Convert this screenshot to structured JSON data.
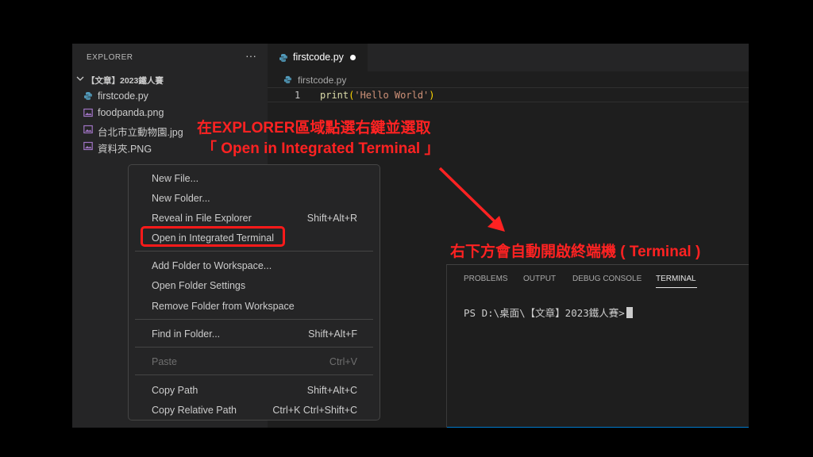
{
  "explorer": {
    "title": "EXPLORER",
    "more_icon": "ellipsis-icon",
    "folder": "【文章】2023鐵人賽",
    "files": [
      {
        "name": "firstcode.py",
        "icon": "python-icon"
      },
      {
        "name": "foodpanda.png",
        "icon": "image-icon"
      },
      {
        "name": "台北市立動物園.jpg",
        "icon": "image-icon"
      },
      {
        "name": "資料夾.PNG",
        "icon": "image-icon"
      }
    ]
  },
  "editor": {
    "tab_label": "firstcode.py",
    "breadcrumb": "firstcode.py",
    "line_number": "1",
    "code": {
      "fn": "print",
      "open": "(",
      "str": "'Hello World'",
      "close": ")"
    }
  },
  "context_menu": {
    "items": [
      {
        "label": "New File...",
        "shortcut": ""
      },
      {
        "label": "New Folder...",
        "shortcut": ""
      },
      {
        "label": "Reveal in File Explorer",
        "shortcut": "Shift+Alt+R"
      },
      {
        "label": "Open in Integrated Terminal",
        "shortcut": ""
      },
      {
        "label": "Add Folder to Workspace...",
        "shortcut": ""
      },
      {
        "label": "Open Folder Settings",
        "shortcut": ""
      },
      {
        "label": "Remove Folder from Workspace",
        "shortcut": ""
      },
      {
        "label": "Find in Folder...",
        "shortcut": "Shift+Alt+F"
      },
      {
        "label": "Paste",
        "shortcut": "Ctrl+V"
      },
      {
        "label": "Copy Path",
        "shortcut": "Shift+Alt+C"
      },
      {
        "label": "Copy Relative Path",
        "shortcut": "Ctrl+K Ctrl+Shift+C"
      }
    ]
  },
  "panel": {
    "tabs": [
      "PROBLEMS",
      "OUTPUT",
      "DEBUG CONSOLE",
      "TERMINAL"
    ],
    "active_tab": "TERMINAL",
    "terminal_prompt": "PS D:\\桌面\\【文章】2023鐵人賽>"
  },
  "annotations": {
    "line1": "在EXPLORER區域點選右鍵並選取",
    "line2": "「 Open in Integrated Terminal 」",
    "line3": "右下方會自動開啟終端機 ( Terminal )"
  },
  "colors": {
    "annotation": "#ff2222",
    "accent": "#007acc",
    "python_icon": "#519aba",
    "image_icon": "#a074c4"
  }
}
